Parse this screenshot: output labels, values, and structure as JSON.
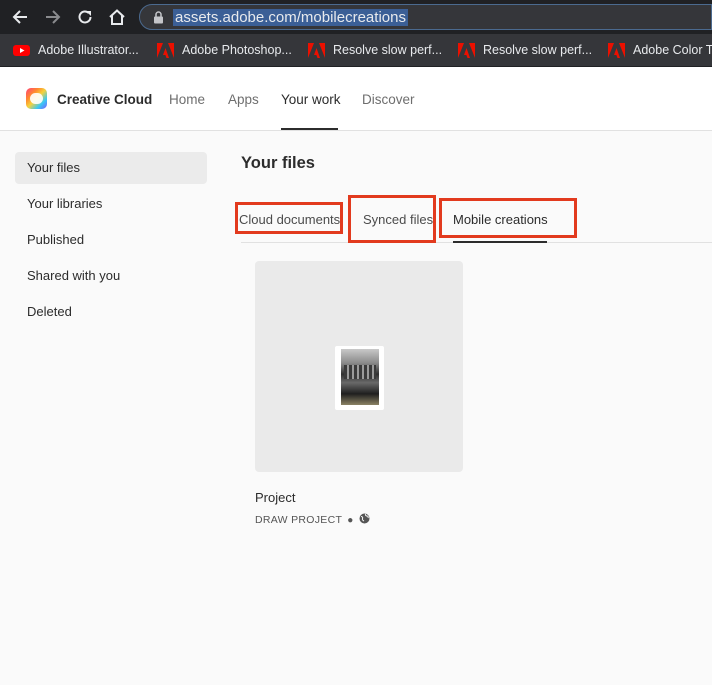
{
  "browser": {
    "url": "assets.adobe.com/mobilecreations",
    "bookmarks": [
      {
        "label": "Adobe Illustrator...",
        "icon": "youtube-icon"
      },
      {
        "label": "Adobe Photoshop...",
        "icon": "adobe-icon"
      },
      {
        "label": "Resolve slow perf...",
        "icon": "adobe-icon"
      },
      {
        "label": "Resolve slow perf...",
        "icon": "adobe-icon"
      },
      {
        "label": "Adobe Color T",
        "icon": "adobe-icon"
      }
    ]
  },
  "header": {
    "brand": "Creative Cloud",
    "nav": [
      "Home",
      "Apps",
      "Your work",
      "Discover"
    ],
    "active_nav": "Your work"
  },
  "sidebar": {
    "items": [
      {
        "label": "Your files",
        "selected": true
      },
      {
        "label": "Your libraries"
      },
      {
        "label": "Published"
      },
      {
        "label": "Shared with you"
      },
      {
        "label": "Deleted"
      }
    ]
  },
  "main": {
    "title": "Your files",
    "tabs": [
      {
        "label": "Cloud documents"
      },
      {
        "label": "Synced files"
      },
      {
        "label": "Mobile creations",
        "active": true
      }
    ],
    "files": [
      {
        "name": "Project",
        "type": "DRAW PROJECT",
        "icon": "globe-icon"
      }
    ]
  },
  "colors": {
    "annotation": "#e23a1e",
    "chrome": "#202124",
    "accent": "#2c2c2c"
  }
}
